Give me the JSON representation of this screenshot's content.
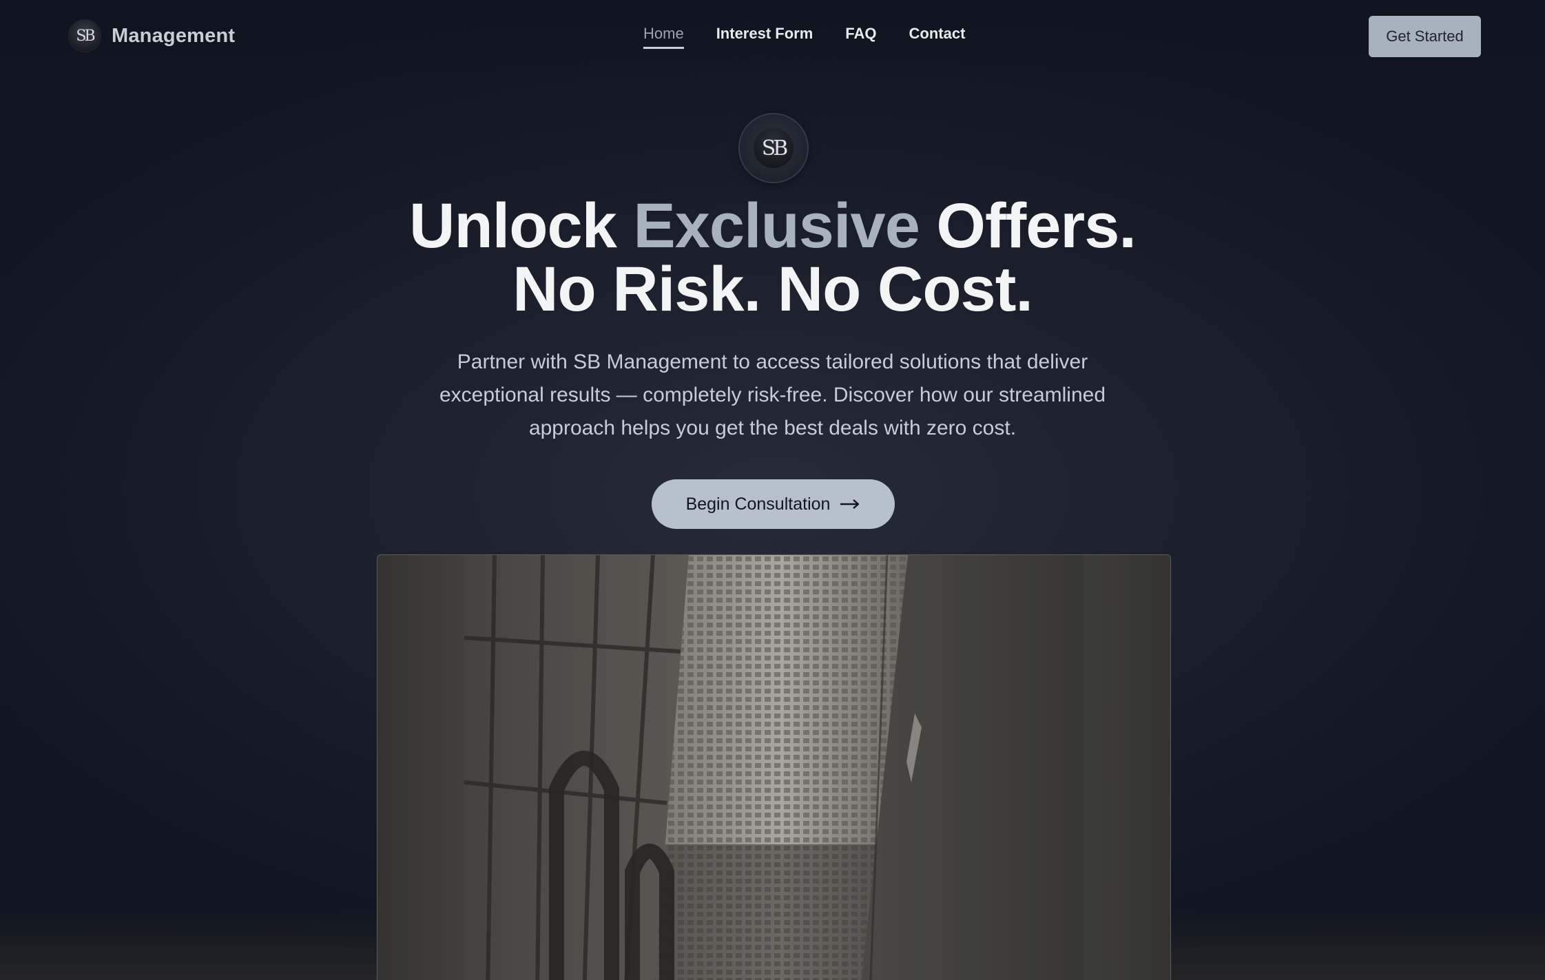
{
  "brand": {
    "logo_initials": "SB",
    "name": "Management"
  },
  "nav": {
    "links": [
      {
        "label": "Home",
        "active": true
      },
      {
        "label": "Interest Form",
        "active": false
      },
      {
        "label": "FAQ",
        "active": false
      },
      {
        "label": "Contact",
        "active": false
      }
    ],
    "cta_label": "Get Started"
  },
  "hero": {
    "logo_initials": "SB",
    "headline": {
      "part1": "Unlock",
      "accent": "Exclusive",
      "part2": "Offers.",
      "line2": "No Risk. No Cost."
    },
    "subtext": "Partner with SB Management to access tailored solutions that deliver exceptional results — completely risk-free. Discover how our streamlined approach helps you get the best deals with zero cost.",
    "cta_label": "Begin Consultation",
    "cta_icon": "arrow-right-icon",
    "image_subject": "building-photo"
  },
  "colors": {
    "background": "#131823",
    "accent_text": "#a8b2bf",
    "button_bg": "#b7c1cb",
    "nav_button_bg": "#a8b2be"
  }
}
